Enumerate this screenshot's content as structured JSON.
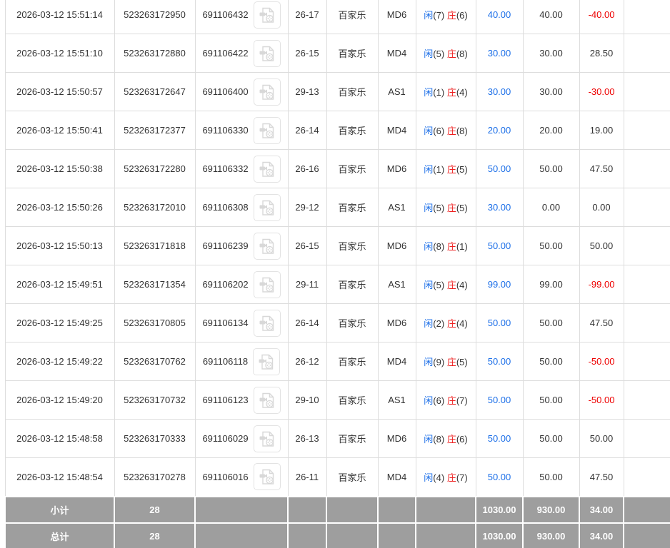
{
  "table": {
    "rows": [
      {
        "time": "2026-03-12 15:51:14",
        "order_no": "523263172950",
        "game_no": "691106432",
        "round": "26-17",
        "game": "百家乐",
        "table_code": "MD6",
        "player_score": "(7)",
        "banker_score": "(6)",
        "valid_bet": "40.00",
        "bet_amount": "40.00",
        "win_loss": "-40.00"
      },
      {
        "time": "2026-03-12 15:51:10",
        "order_no": "523263172880",
        "game_no": "691106422",
        "round": "26-15",
        "game": "百家乐",
        "table_code": "MD4",
        "player_score": "(5)",
        "banker_score": "(8)",
        "valid_bet": "30.00",
        "bet_amount": "30.00",
        "win_loss": "28.50"
      },
      {
        "time": "2026-03-12 15:50:57",
        "order_no": "523263172647",
        "game_no": "691106400",
        "round": "29-13",
        "game": "百家乐",
        "table_code": "AS1",
        "player_score": "(1)",
        "banker_score": "(4)",
        "valid_bet": "30.00",
        "bet_amount": "30.00",
        "win_loss": "-30.00"
      },
      {
        "time": "2026-03-12 15:50:41",
        "order_no": "523263172377",
        "game_no": "691106330",
        "round": "26-14",
        "game": "百家乐",
        "table_code": "MD4",
        "player_score": "(6)",
        "banker_score": "(8)",
        "valid_bet": "20.00",
        "bet_amount": "20.00",
        "win_loss": "19.00"
      },
      {
        "time": "2026-03-12 15:50:38",
        "order_no": "523263172280",
        "game_no": "691106332",
        "round": "26-16",
        "game": "百家乐",
        "table_code": "MD6",
        "player_score": "(1)",
        "banker_score": "(5)",
        "valid_bet": "50.00",
        "bet_amount": "50.00",
        "win_loss": "47.50"
      },
      {
        "time": "2026-03-12 15:50:26",
        "order_no": "523263172010",
        "game_no": "691106308",
        "round": "29-12",
        "game": "百家乐",
        "table_code": "AS1",
        "player_score": "(5)",
        "banker_score": "(5)",
        "valid_bet": "30.00",
        "bet_amount": "0.00",
        "win_loss": "0.00"
      },
      {
        "time": "2026-03-12 15:50:13",
        "order_no": "523263171818",
        "game_no": "691106239",
        "round": "26-15",
        "game": "百家乐",
        "table_code": "MD6",
        "player_score": "(8)",
        "banker_score": "(1)",
        "valid_bet": "50.00",
        "bet_amount": "50.00",
        "win_loss": "50.00"
      },
      {
        "time": "2026-03-12 15:49:51",
        "order_no": "523263171354",
        "game_no": "691106202",
        "round": "29-11",
        "game": "百家乐",
        "table_code": "AS1",
        "player_score": "(5)",
        "banker_score": "(4)",
        "valid_bet": "99.00",
        "bet_amount": "99.00",
        "win_loss": "-99.00"
      },
      {
        "time": "2026-03-12 15:49:25",
        "order_no": "523263170805",
        "game_no": "691106134",
        "round": "26-14",
        "game": "百家乐",
        "table_code": "MD6",
        "player_score": "(2)",
        "banker_score": "(4)",
        "valid_bet": "50.00",
        "bet_amount": "50.00",
        "win_loss": "47.50"
      },
      {
        "time": "2026-03-12 15:49:22",
        "order_no": "523263170762",
        "game_no": "691106118",
        "round": "26-12",
        "game": "百家乐",
        "table_code": "MD4",
        "player_score": "(9)",
        "banker_score": "(5)",
        "valid_bet": "50.00",
        "bet_amount": "50.00",
        "win_loss": "-50.00"
      },
      {
        "time": "2026-03-12 15:49:20",
        "order_no": "523263170732",
        "game_no": "691106123",
        "round": "29-10",
        "game": "百家乐",
        "table_code": "AS1",
        "player_score": "(6)",
        "banker_score": "(7)",
        "valid_bet": "50.00",
        "bet_amount": "50.00",
        "win_loss": "-50.00"
      },
      {
        "time": "2026-03-12 15:48:58",
        "order_no": "523263170333",
        "game_no": "691106029",
        "round": "26-13",
        "game": "百家乐",
        "table_code": "MD6",
        "player_score": "(8)",
        "banker_score": "(6)",
        "valid_bet": "50.00",
        "bet_amount": "50.00",
        "win_loss": "50.00"
      },
      {
        "time": "2026-03-12 15:48:54",
        "order_no": "523263170278",
        "game_no": "691106016",
        "round": "26-11",
        "game": "百家乐",
        "table_code": "MD4",
        "player_score": "(4)",
        "banker_score": "(7)",
        "valid_bet": "50.00",
        "bet_amount": "50.00",
        "win_loss": "47.50"
      }
    ],
    "result_labels": {
      "player": "闲",
      "banker": "庄"
    },
    "footer_rows": [
      {
        "label": "小计",
        "count": "28",
        "valid_bet": "1030.00",
        "bet_amount": "930.00",
        "win_loss": "34.00"
      },
      {
        "label": "总计",
        "count": "28",
        "valid_bet": "1030.00",
        "bet_amount": "930.00",
        "win_loss": "34.00"
      }
    ],
    "icons": {
      "video": "video-record-icon"
    },
    "colors": {
      "link_blue": "#1c6fe8",
      "player_blue": "#1c6fe8",
      "banker_red": "#ee2020",
      "negative_red": "#ee0000",
      "footer_bg": "#9e9e9e",
      "footer_text": "#ffffff",
      "border": "#dddddd",
      "text": "#333333"
    }
  }
}
